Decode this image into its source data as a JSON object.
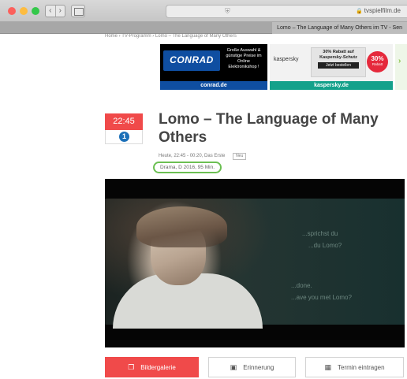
{
  "browser": {
    "address_url": "tvspielfilm.de",
    "tab_title": "Lomo – The Language of Many Others im TV - Sen"
  },
  "breadcrumb": "Home › TV-Programm › Lomo – The Language of Many Others",
  "ads": {
    "conrad": {
      "logo": "CONRAD",
      "text": "Große Auswahl & günstige Preise im Online Elektronikshop !",
      "caption": "conrad.de"
    },
    "kaspersky": {
      "logo": "kaspersky",
      "offer": "30% Rabatt auf Kaspersky-Schutz",
      "cta": "Jetzt bestellen",
      "badge_value": "30%",
      "badge_label": "Rabatt",
      "caption": "kaspersky.de"
    }
  },
  "program": {
    "time": "22:45",
    "channel_logo": "1",
    "title": "Lomo – The Language of Many Others",
    "meta": "Heute, 22:45 - 00:20, Das Erste",
    "meta_tag": "Neu",
    "genre_line": "Drama, D 2016, 95 Min."
  },
  "video": {
    "subtitles": [
      "...sprichst du",
      "...du Lomo?",
      "...done.",
      "...ave you met Lomo?"
    ]
  },
  "buttons": {
    "gallery": "Bildergalerie",
    "reminder": "Erinnerung",
    "calendar": "Termin eintragen"
  },
  "icons": {
    "gallery": "gallery-icon",
    "reminder": "reminder-icon",
    "calendar": "calendar-icon"
  },
  "colors": {
    "accent": "#f04a4a",
    "highlight": "#6bbf52"
  }
}
